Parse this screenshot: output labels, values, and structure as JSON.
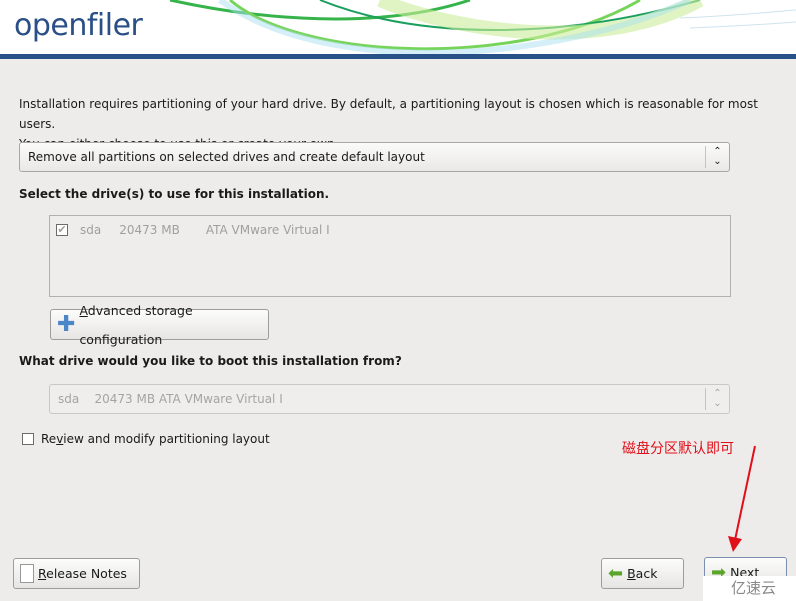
{
  "header": {
    "logo": "openfiler"
  },
  "intro": {
    "line1": "Installation requires partitioning of your hard drive.  By default, a partitioning layout is chosen which is reasonable for most users.",
    "line2": "You can either choose to use this or create your own."
  },
  "layout_select": {
    "value": "Remove all partitions on selected drives and create default layout"
  },
  "drives": {
    "label": "Select the drive(s) to use for this installation.",
    "rows": [
      {
        "checked": true,
        "name": "sda",
        "size": "20473 MB",
        "model": "ATA VMware Virtual I"
      }
    ]
  },
  "advanced": {
    "label_first": "A",
    "label_rest": "dvanced storage configuration"
  },
  "boot": {
    "label": "What drive would you like to boot this installation from?",
    "value": "sda    20473 MB ATA VMware Virtual I"
  },
  "review": {
    "checked": false,
    "label_first": "Re",
    "label_u": "v",
    "label_rest": "iew and modify partitioning layout"
  },
  "annotation": {
    "text": "磁盘分区默认即可",
    "color": "#e0101a"
  },
  "buttons": {
    "release_u": "R",
    "release_rest": "elease Notes",
    "back_u": "B",
    "back_rest": "ack",
    "next_u": "N",
    "next_rest": "ext"
  },
  "watermark": "亿速云"
}
